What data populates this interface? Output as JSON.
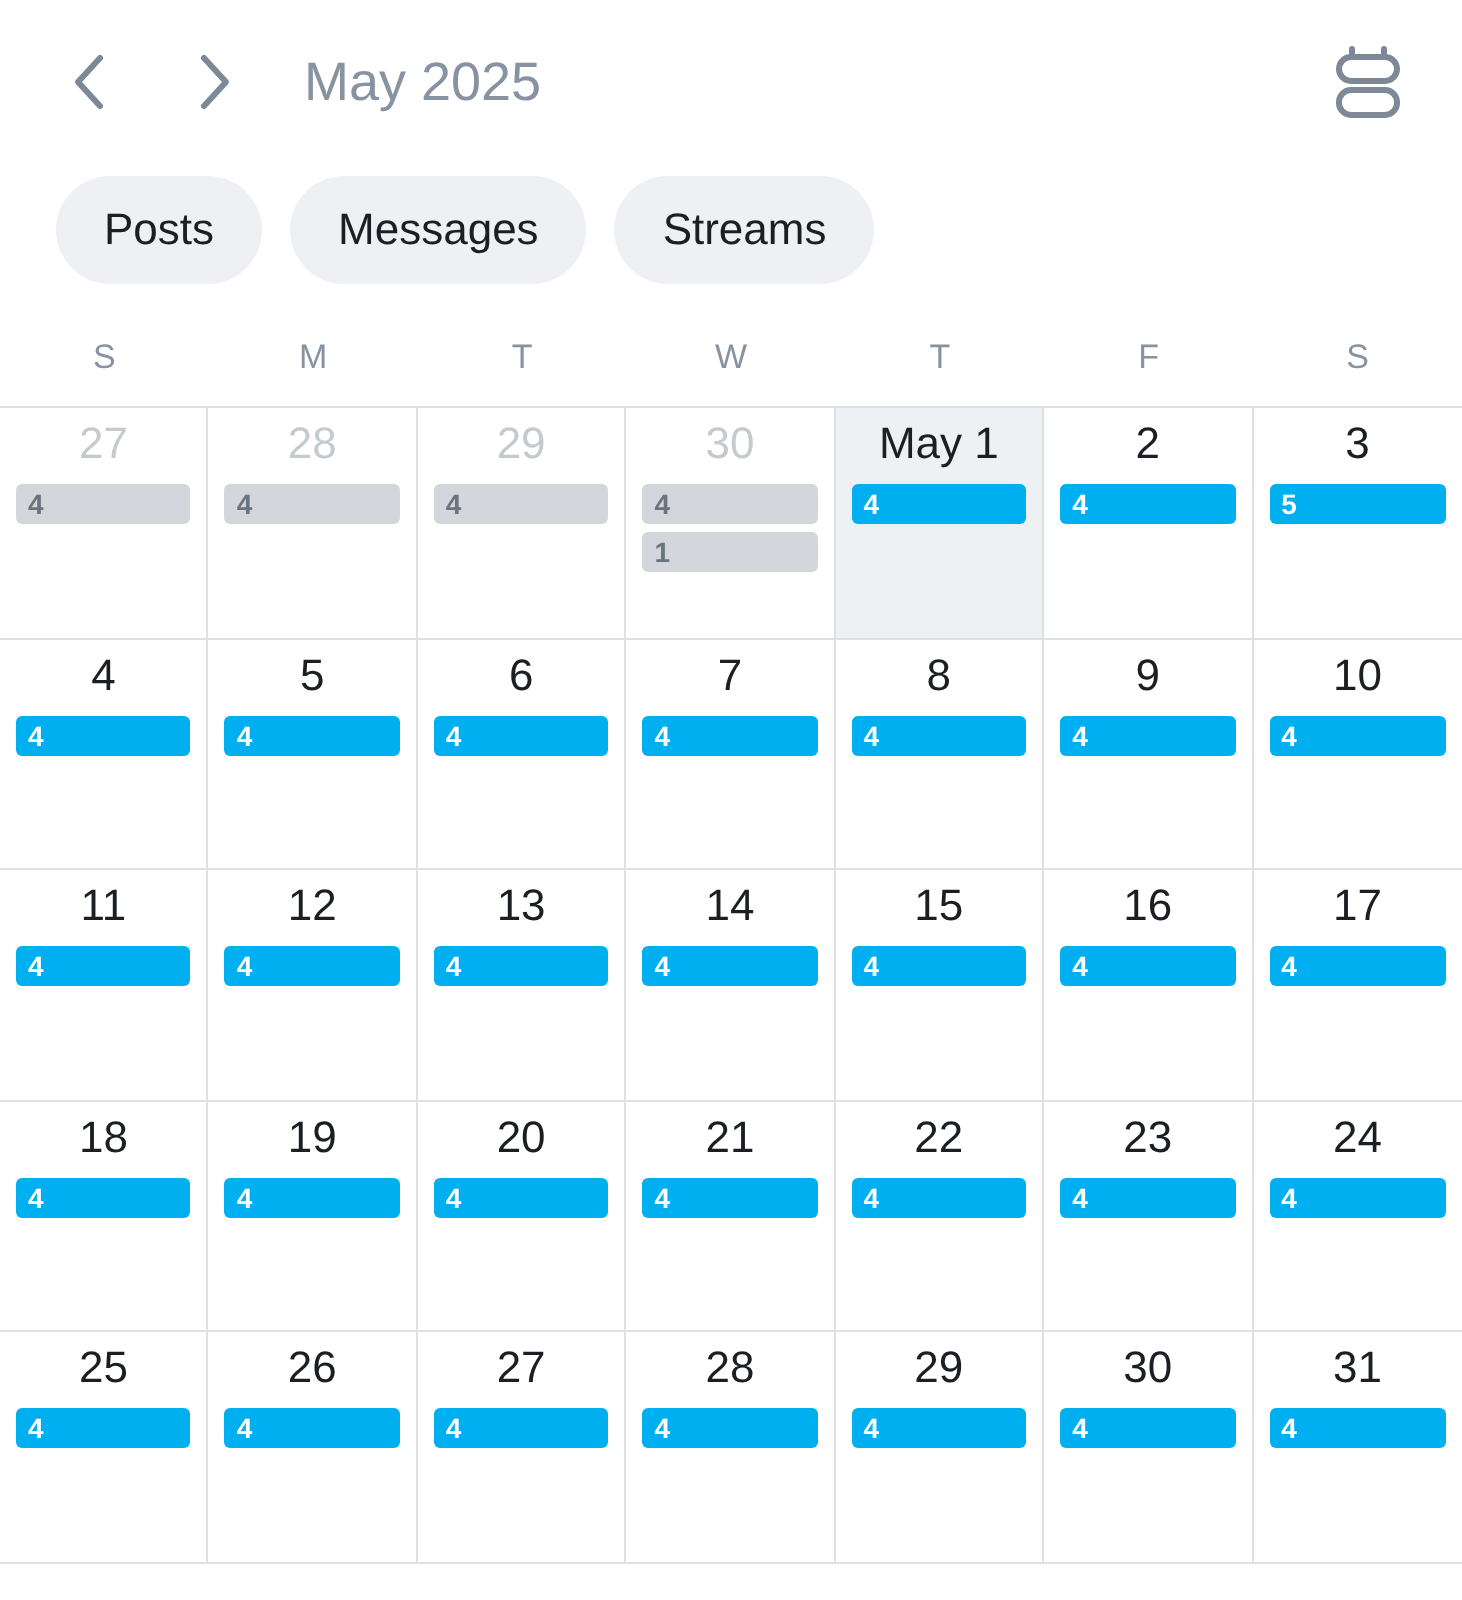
{
  "header": {
    "month": "May 2025"
  },
  "filters": [
    {
      "label": "Posts",
      "selected": false
    },
    {
      "label": "Messages",
      "selected": false
    },
    {
      "label": "Streams",
      "selected": false
    }
  ],
  "weekdays": [
    "S",
    "M",
    "T",
    "W",
    "T",
    "F",
    "S"
  ],
  "weeks": [
    [
      {
        "day": "27",
        "in_month": false,
        "today": false,
        "counts": [
          "4"
        ]
      },
      {
        "day": "28",
        "in_month": false,
        "today": false,
        "counts": [
          "4"
        ]
      },
      {
        "day": "29",
        "in_month": false,
        "today": false,
        "counts": [
          "4"
        ]
      },
      {
        "day": "30",
        "in_month": false,
        "today": false,
        "counts": [
          "4",
          "1"
        ]
      },
      {
        "day": "May 1",
        "in_month": true,
        "today": true,
        "counts": [
          "4"
        ]
      },
      {
        "day": "2",
        "in_month": true,
        "today": false,
        "counts": [
          "4"
        ]
      },
      {
        "day": "3",
        "in_month": true,
        "today": false,
        "counts": [
          "5"
        ]
      }
    ],
    [
      {
        "day": "4",
        "in_month": true,
        "today": false,
        "counts": [
          "4"
        ]
      },
      {
        "day": "5",
        "in_month": true,
        "today": false,
        "counts": [
          "4"
        ]
      },
      {
        "day": "6",
        "in_month": true,
        "today": false,
        "counts": [
          "4"
        ]
      },
      {
        "day": "7",
        "in_month": true,
        "today": false,
        "counts": [
          "4"
        ]
      },
      {
        "day": "8",
        "in_month": true,
        "today": false,
        "counts": [
          "4"
        ]
      },
      {
        "day": "9",
        "in_month": true,
        "today": false,
        "counts": [
          "4"
        ]
      },
      {
        "day": "10",
        "in_month": true,
        "today": false,
        "counts": [
          "4"
        ]
      }
    ],
    [
      {
        "day": "11",
        "in_month": true,
        "today": false,
        "counts": [
          "4"
        ]
      },
      {
        "day": "12",
        "in_month": true,
        "today": false,
        "counts": [
          "4"
        ]
      },
      {
        "day": "13",
        "in_month": true,
        "today": false,
        "counts": [
          "4"
        ]
      },
      {
        "day": "14",
        "in_month": true,
        "today": false,
        "counts": [
          "4"
        ]
      },
      {
        "day": "15",
        "in_month": true,
        "today": false,
        "counts": [
          "4"
        ]
      },
      {
        "day": "16",
        "in_month": true,
        "today": false,
        "counts": [
          "4"
        ]
      },
      {
        "day": "17",
        "in_month": true,
        "today": false,
        "counts": [
          "4"
        ]
      }
    ],
    [
      {
        "day": "18",
        "in_month": true,
        "today": false,
        "counts": [
          "4"
        ]
      },
      {
        "day": "19",
        "in_month": true,
        "today": false,
        "counts": [
          "4"
        ]
      },
      {
        "day": "20",
        "in_month": true,
        "today": false,
        "counts": [
          "4"
        ]
      },
      {
        "day": "21",
        "in_month": true,
        "today": false,
        "counts": [
          "4"
        ]
      },
      {
        "day": "22",
        "in_month": true,
        "today": false,
        "counts": [
          "4"
        ]
      },
      {
        "day": "23",
        "in_month": true,
        "today": false,
        "counts": [
          "4"
        ]
      },
      {
        "day": "24",
        "in_month": true,
        "today": false,
        "counts": [
          "4"
        ]
      }
    ],
    [
      {
        "day": "25",
        "in_month": true,
        "today": false,
        "counts": [
          "4"
        ]
      },
      {
        "day": "26",
        "in_month": true,
        "today": false,
        "counts": [
          "4"
        ]
      },
      {
        "day": "27",
        "in_month": true,
        "today": false,
        "counts": [
          "4"
        ]
      },
      {
        "day": "28",
        "in_month": true,
        "today": false,
        "counts": [
          "4"
        ]
      },
      {
        "day": "29",
        "in_month": true,
        "today": false,
        "counts": [
          "4"
        ]
      },
      {
        "day": "30",
        "in_month": true,
        "today": false,
        "counts": [
          "4"
        ]
      },
      {
        "day": "31",
        "in_month": true,
        "today": false,
        "counts": [
          "4"
        ]
      }
    ]
  ]
}
